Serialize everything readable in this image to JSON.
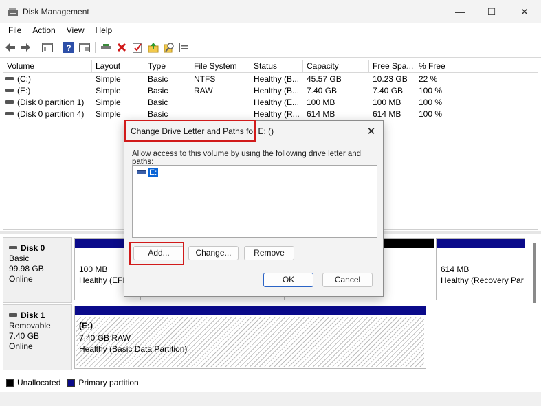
{
  "window": {
    "title": "Disk Management",
    "minimize": "—",
    "maximize": "☐",
    "close": "✕"
  },
  "menu": [
    "File",
    "Action",
    "View",
    "Help"
  ],
  "toolbar": {
    "icons": [
      "back-icon",
      "forward-icon",
      "console-tree-icon",
      "help-icon",
      "properties-icon",
      "connect-icon",
      "delete-icon",
      "check-icon",
      "export-icon",
      "search-icon",
      "list-icon"
    ]
  },
  "list": {
    "columns": [
      "Volume",
      "Layout",
      "Type",
      "File System",
      "Status",
      "Capacity",
      "Free Spa...",
      "% Free"
    ],
    "rows": [
      [
        "(C:)",
        "Simple",
        "Basic",
        "NTFS",
        "Healthy (B...",
        "45.57 GB",
        "10.23 GB",
        "22 %"
      ],
      [
        "(E:)",
        "Simple",
        "Basic",
        "RAW",
        "Healthy (B...",
        "7.40 GB",
        "7.40 GB",
        "100 %"
      ],
      [
        "(Disk 0 partition 1)",
        "Simple",
        "Basic",
        "",
        "Healthy (E...",
        "100 MB",
        "100 MB",
        "100 %"
      ],
      [
        "(Disk 0 partition 4)",
        "Simple",
        "Basic",
        "",
        "Healthy (R...",
        "614 MB",
        "614 MB",
        "100 %"
      ]
    ]
  },
  "disks": [
    {
      "name": "Disk 0",
      "type": "Basic",
      "size": "99.98 GB",
      "state": "Online",
      "partitions": [
        {
          "size": "100 MB",
          "status": "Healthy (EFI"
        },
        {
          "size": "614 MB",
          "status": "Healthy (Recovery Par"
        }
      ]
    },
    {
      "name": "Disk 1",
      "type": "Removable",
      "size": "7.40 GB",
      "state": "Online",
      "partitions": [
        {
          "label": "(E:)",
          "size": "7.40 GB RAW",
          "status": "Healthy (Basic Data Partition)"
        }
      ]
    }
  ],
  "legend": [
    {
      "label": "Unallocated",
      "color": "#000000"
    },
    {
      "label": "Primary partition",
      "color": "#0a0a8a"
    }
  ],
  "dialog": {
    "title": "Change Drive Letter and Paths for E: ()",
    "close": "✕",
    "description": "Allow access to this volume by using the following drive letter and paths:",
    "paths": [
      "E:"
    ],
    "buttons": {
      "add": "Add...",
      "change": "Change...",
      "remove": "Remove",
      "ok": "OK",
      "cancel": "Cancel"
    }
  },
  "colors": {
    "primary_partition": "#0a0a8a",
    "highlight": "#d11a1a",
    "selection": "#0a64d6"
  }
}
